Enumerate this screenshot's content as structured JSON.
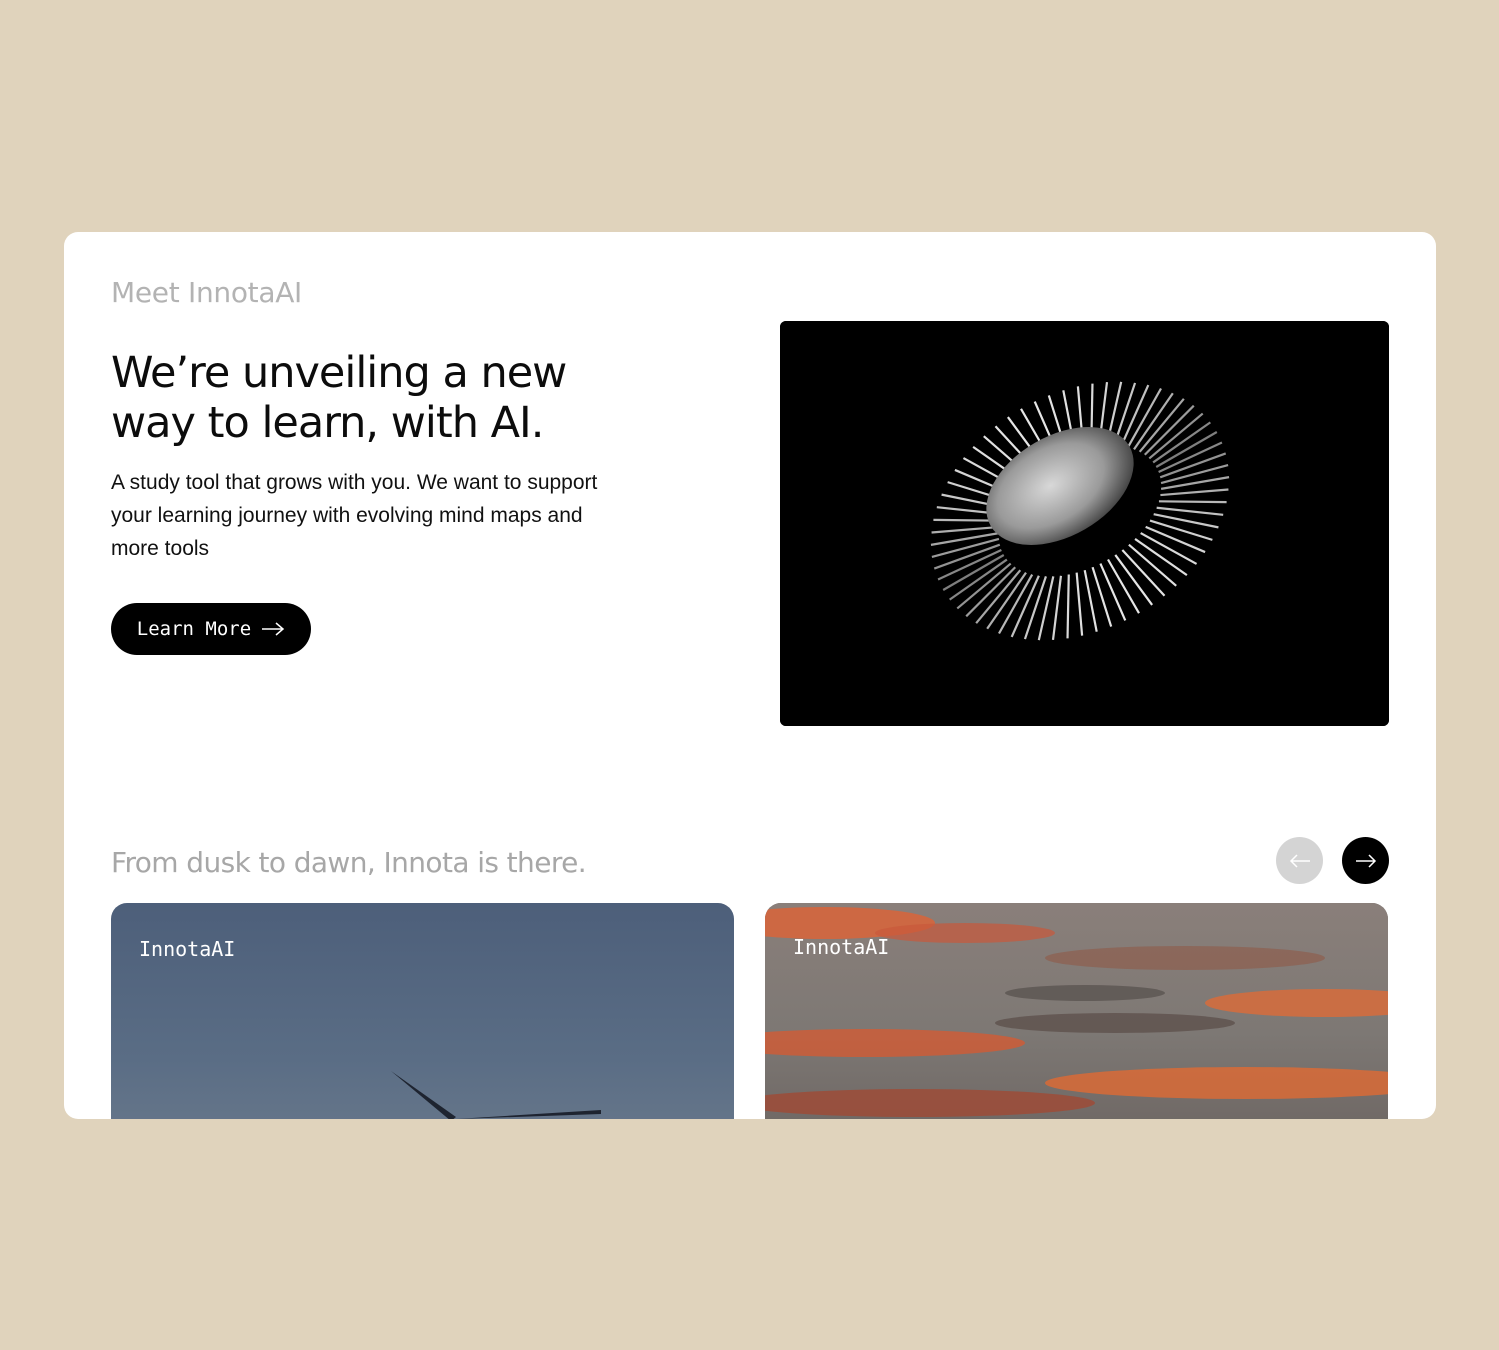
{
  "hero": {
    "eyebrow": "Meet InnotaAI",
    "headline": "We’re unveiling a new way to learn, with AI.",
    "body": "A study tool that grows with you. We want to support your learning journey with evolving mind maps and more tools",
    "cta_label": "Learn More",
    "cta_icon": "arrow-right-icon",
    "image": "metal-heatsink-render"
  },
  "carousel": {
    "title": "From dusk to dawn, Innota is there.",
    "prev_icon": "arrow-left-icon",
    "next_icon": "arrow-right-icon",
    "slides": [
      {
        "label": "InnotaAI",
        "image": "wind-turbine-dusk-sky"
      },
      {
        "label": "InnotaAI",
        "image": "sunset-clouds-sky"
      }
    ]
  },
  "colors": {
    "page_background": "#e0d3bc",
    "card_background": "#ffffff",
    "primary_button": "#000000",
    "muted_text": "#b3b3b3",
    "disabled_nav": "#d4d4d4"
  }
}
